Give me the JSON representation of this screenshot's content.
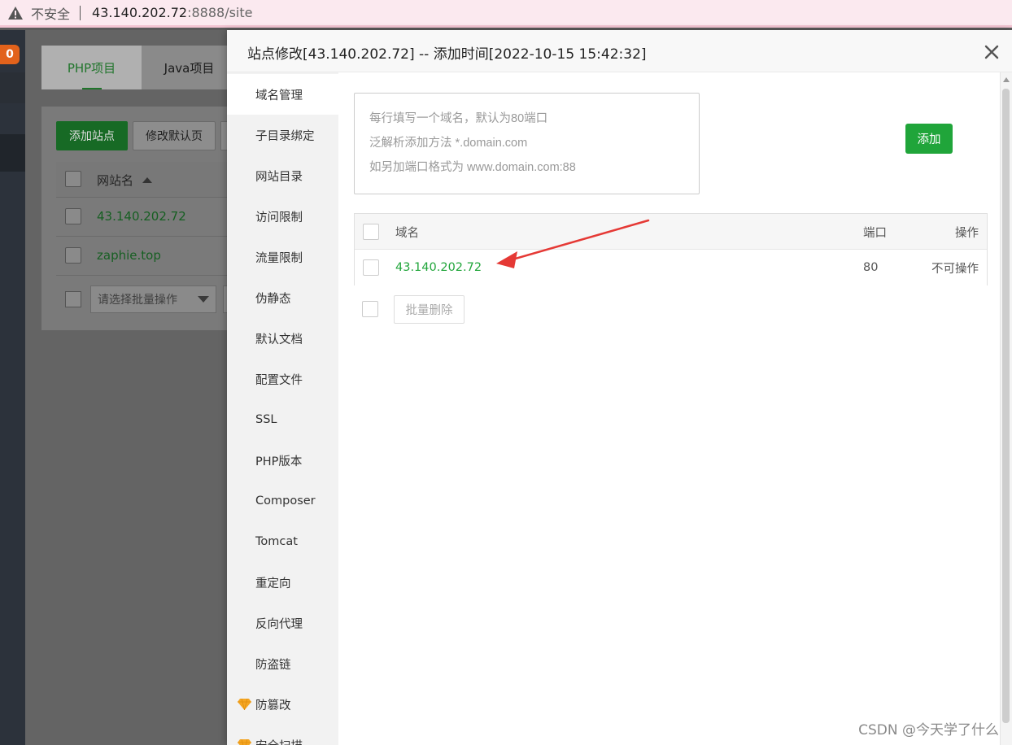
{
  "browser": {
    "security_label": "不安全",
    "host": "43.140.202.72",
    "path": ":8888/site"
  },
  "sidebar": {
    "badge": "0"
  },
  "background": {
    "tabs": [
      "PHP项目",
      "Java项目"
    ],
    "add_site_label": "添加站点",
    "modify_default_label": "修改默认页",
    "table_header_site_name": "网站名",
    "rows": [
      "43.140.202.72",
      "zaphie.top"
    ],
    "batch_placeholder": "请选择批量操作"
  },
  "modal": {
    "title": "站点修改[43.140.202.72] -- 添加时间[2022-10-15 15:42:32]",
    "nav_items": [
      "域名管理",
      "子目录绑定",
      "网站目录",
      "访问限制",
      "流量限制",
      "伪静态",
      "默认文档",
      "配置文件",
      "SSL",
      "PHP版本",
      "Composer",
      "Tomcat",
      "重定向",
      "反向代理",
      "防盗链",
      "防篡改",
      "安全扫描"
    ],
    "textarea_placeholder_lines": [
      "每行填写一个域名，默认为80端口",
      "泛解析添加方法 *.domain.com",
      "如另加端口格式为 www.domain.com:88"
    ],
    "add_button": "添加",
    "table": {
      "headers": {
        "domain": "域名",
        "port": "端口",
        "action": "操作"
      },
      "rows": [
        {
          "domain": "43.140.202.72",
          "port": "80",
          "action": "不可操作"
        }
      ]
    },
    "batch_delete": "批量删除"
  },
  "watermark": "CSDN @今天学了什么",
  "colors": {
    "accent_green": "#20a53a",
    "annotation_red": "#e53935"
  }
}
